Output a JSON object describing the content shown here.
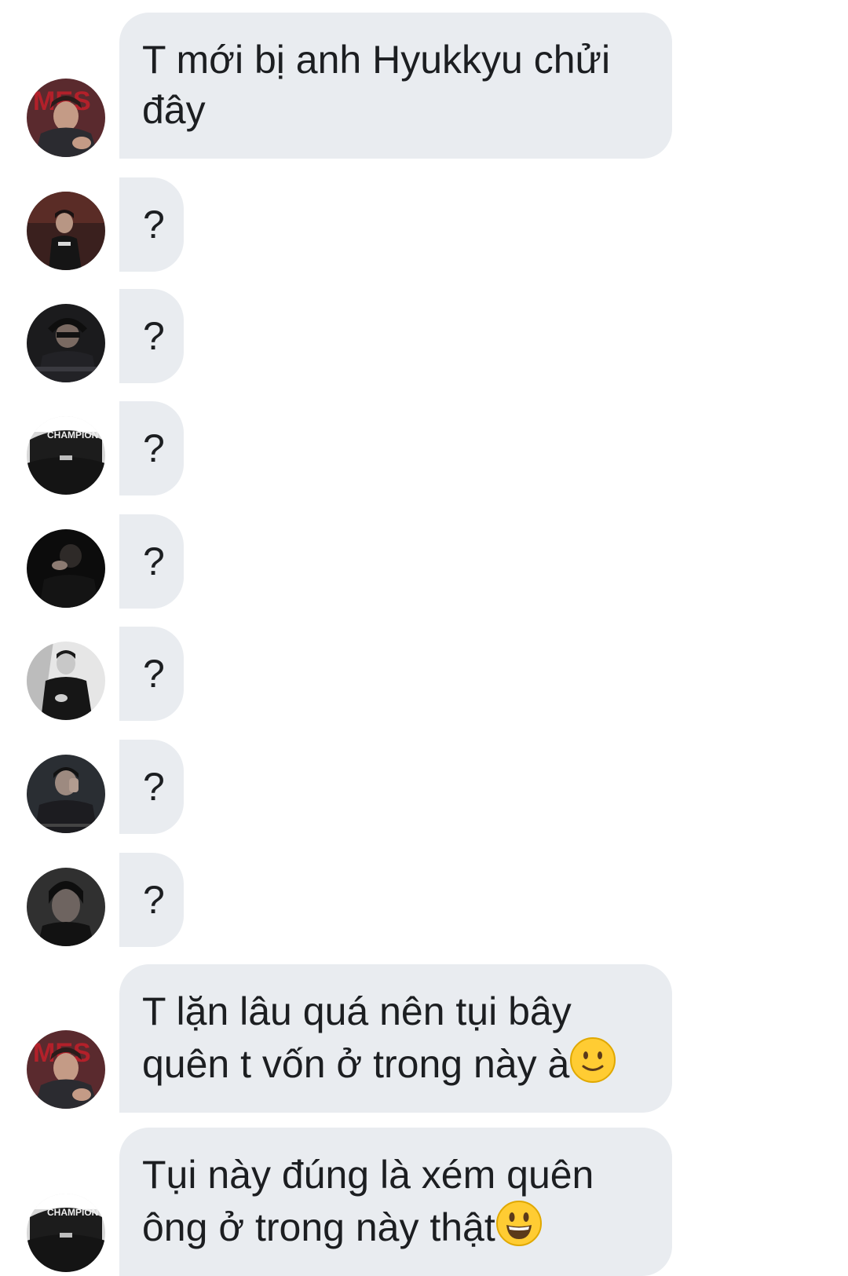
{
  "messages": [
    {
      "text": "T mới bị anh Hyukkyu chửi đây",
      "avatar": "avatar-1-red-mes"
    },
    {
      "text": "?",
      "avatar": "avatar-2-dark"
    },
    {
      "text": "?",
      "avatar": "avatar-3-headphones"
    },
    {
      "text": "?",
      "avatar": "avatar-4-champion-bw"
    },
    {
      "text": "?",
      "avatar": "avatar-5-black"
    },
    {
      "text": "?",
      "avatar": "avatar-6-bw-suit"
    },
    {
      "text": "?",
      "avatar": "avatar-7-dark-jacket"
    },
    {
      "text": "?",
      "avatar": "avatar-8-dark-portrait"
    },
    {
      "text": "T lặn lâu quá nên tụi bây quên t vốn ở trong này à",
      "emoji": "slightly-smiling-face",
      "avatar": "avatar-1-red-mes"
    },
    {
      "text": "Tụi này đúng là xém quên ông ở trong này thật",
      "emoji": "grinning-face",
      "avatar": "avatar-4-champion-bw"
    }
  ],
  "colors": {
    "bubble": "#e9ecf0",
    "text": "#1c1e21",
    "background": "#ffffff"
  }
}
